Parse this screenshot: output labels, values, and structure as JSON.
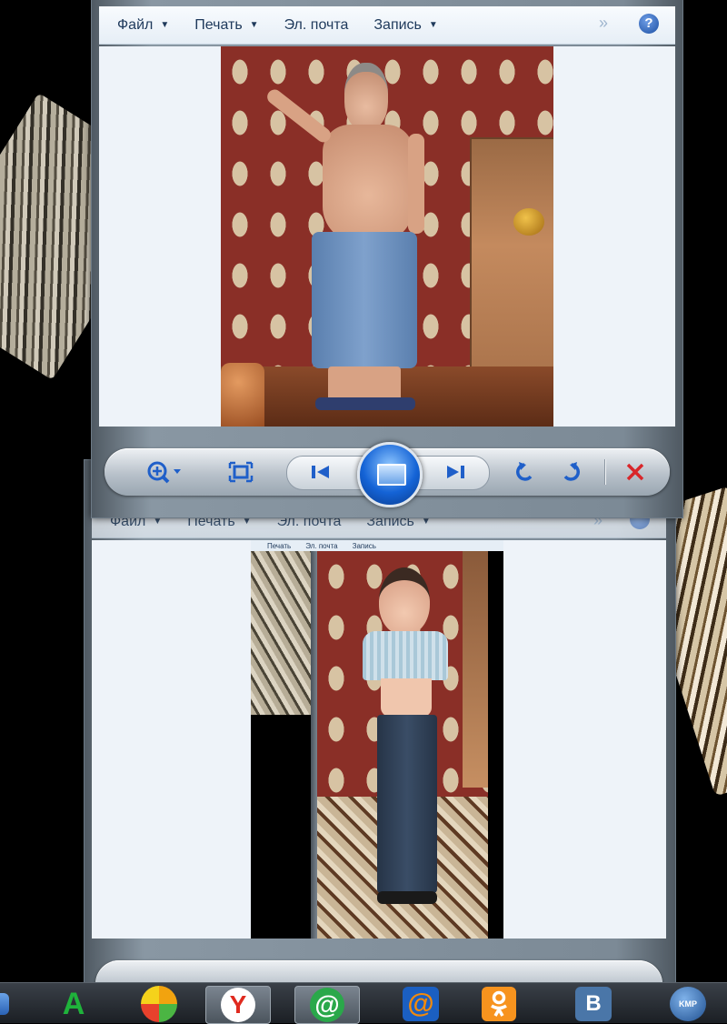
{
  "window_top": {
    "menu": [
      {
        "label": "Файл"
      },
      {
        "label": "Печать"
      },
      {
        "label": "Эл. почта"
      },
      {
        "label": "Запись"
      }
    ],
    "more_glyph": "»",
    "help_glyph": "?"
  },
  "window_bottom": {
    "menu": [
      {
        "label": "Файл"
      },
      {
        "label": "Печать"
      },
      {
        "label": "Эл. почта"
      },
      {
        "label": "Запись"
      }
    ],
    "inner_menu": [
      {
        "label": "Печать"
      },
      {
        "label": "Эл. почта"
      },
      {
        "label": "Запись"
      }
    ],
    "more_glyph": "»"
  },
  "toolbar": {
    "zoom_icon": "zoom-icon",
    "fit_icon": "fit-to-window-icon",
    "prev_icon": "previous-icon",
    "slideshow_icon": "slideshow-icon",
    "next_icon": "next-icon",
    "rotate_ccw_icon": "rotate-counterclockwise-icon",
    "rotate_cw_icon": "rotate-clockwise-icon",
    "delete_icon": "delete-icon"
  },
  "taskbar": {
    "apps": [
      {
        "name": "green-a-icon",
        "glyph": "A",
        "color": "#1fb33b"
      },
      {
        "name": "colorful-ball-icon",
        "glyph": "",
        "color": "#f2a30f"
      },
      {
        "name": "yandex-browser-icon",
        "glyph": "Y",
        "color": "#e02a1f"
      },
      {
        "name": "mail-agent-icon",
        "glyph": "@",
        "color": "#2aa84a"
      },
      {
        "name": "mail-ru-icon",
        "glyph": "@",
        "color": "#f28a0c"
      },
      {
        "name": "odnoklassniki-icon",
        "glyph": "ok",
        "color": "#f7931e"
      },
      {
        "name": "vkontakte-icon",
        "glyph": "B",
        "color": "#4a76a8"
      },
      {
        "name": "kmplayer-icon",
        "glyph": "KMP",
        "color": "#2a6fb8"
      }
    ]
  },
  "colors": {
    "menu_text": "#1e395b",
    "toolbar_accent": "#1f5fc9",
    "delete_red": "#d9262a"
  }
}
